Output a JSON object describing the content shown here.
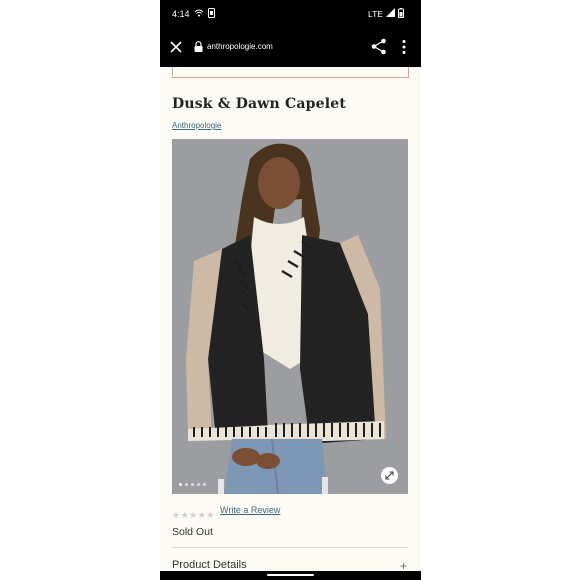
{
  "status_bar": {
    "time": "4:14",
    "network": "LTE"
  },
  "browser": {
    "url": "anthropologie.com"
  },
  "product": {
    "title": "Dusk & Dawn Capelet",
    "brand": "Anthropologie",
    "rating_stars": 5,
    "write_review_label": "Write a Review",
    "stock_status": "Sold Out",
    "details_label": "Product Details",
    "details_toggle": "+"
  },
  "gallery": {
    "slide_count": 5,
    "active_slide": 1
  },
  "colors": {
    "status_bar": "#000000",
    "page_bg": "#fbfaf5",
    "link": "#3c6b78"
  },
  "icons": [
    "close-icon",
    "lock-icon",
    "share-icon",
    "more-vert-icon",
    "expand-icon",
    "star-icon"
  ]
}
